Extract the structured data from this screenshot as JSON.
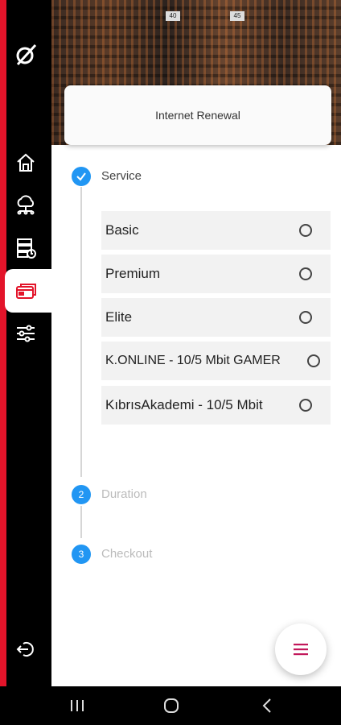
{
  "header": {
    "rack_tags": [
      "40",
      "45"
    ]
  },
  "sidebar": {
    "items": [
      {
        "icon": "logo-icon"
      },
      {
        "icon": "home-icon"
      },
      {
        "icon": "cloud-network-icon"
      },
      {
        "icon": "server-clock-icon"
      },
      {
        "icon": "payment-card-icon",
        "active": true
      },
      {
        "icon": "sliders-icon"
      },
      {
        "icon": "logout-icon"
      }
    ]
  },
  "page": {
    "title": "Internet Renewal"
  },
  "steps": [
    {
      "number": "✓",
      "label": "Service",
      "state": "done"
    },
    {
      "number": "2",
      "label": "Duration",
      "state": "pending"
    },
    {
      "number": "3",
      "label": "Checkout",
      "state": "pending"
    }
  ],
  "options": [
    "Basic",
    "Premium",
    "Elite",
    "K.ONLINE - 10/5 Mbit GAMER",
    "KıbrısAkademi - 10/5 Mbit"
  ],
  "colors": {
    "accent_red": "#e3142a",
    "step_blue": "#2196f3",
    "fab_icon": "#c2185b"
  }
}
